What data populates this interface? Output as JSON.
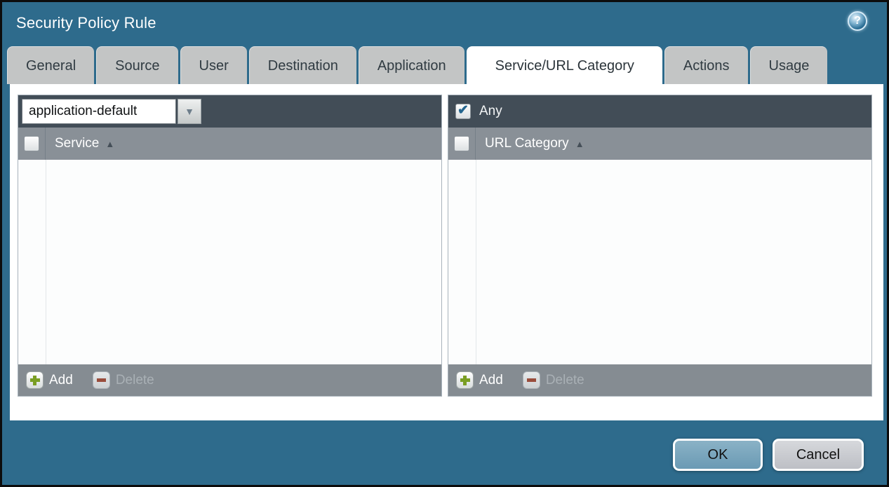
{
  "window": {
    "title": "Security Policy Rule"
  },
  "tabs": [
    {
      "label": "General",
      "active": false
    },
    {
      "label": "Source",
      "active": false
    },
    {
      "label": "User",
      "active": false
    },
    {
      "label": "Destination",
      "active": false
    },
    {
      "label": "Application",
      "active": false
    },
    {
      "label": "Service/URL Category",
      "active": true
    },
    {
      "label": "Actions",
      "active": false
    },
    {
      "label": "Usage",
      "active": false
    }
  ],
  "service_panel": {
    "dropdown": {
      "value": "application-default"
    },
    "column_header": "Service",
    "rows": [],
    "add_label": "Add",
    "delete_label": "Delete",
    "delete_enabled": false
  },
  "url_category_panel": {
    "any_label": "Any",
    "any_checked": true,
    "column_header": "URL Category",
    "rows": [],
    "add_label": "Add",
    "delete_label": "Delete",
    "delete_enabled": false
  },
  "footer_buttons": {
    "ok": "OK",
    "cancel": "Cancel"
  },
  "icons": {
    "help": "?",
    "sort_asc": "▲",
    "dropdown_arrow": "▼",
    "check": "✔"
  },
  "colors": {
    "teal_background": "#2e6b8c",
    "dark_bar": "#424d57",
    "column_header_gray": "#899097",
    "panel_footer_gray": "#858c92",
    "tab_gray": "#c3c5c5",
    "ok_button_blue": "#73a2bb",
    "cancel_button_gray": "#c6c8cd",
    "add_green": "#7a9e23",
    "delete_red": "#9c4632",
    "check_blue": "#25668f"
  }
}
